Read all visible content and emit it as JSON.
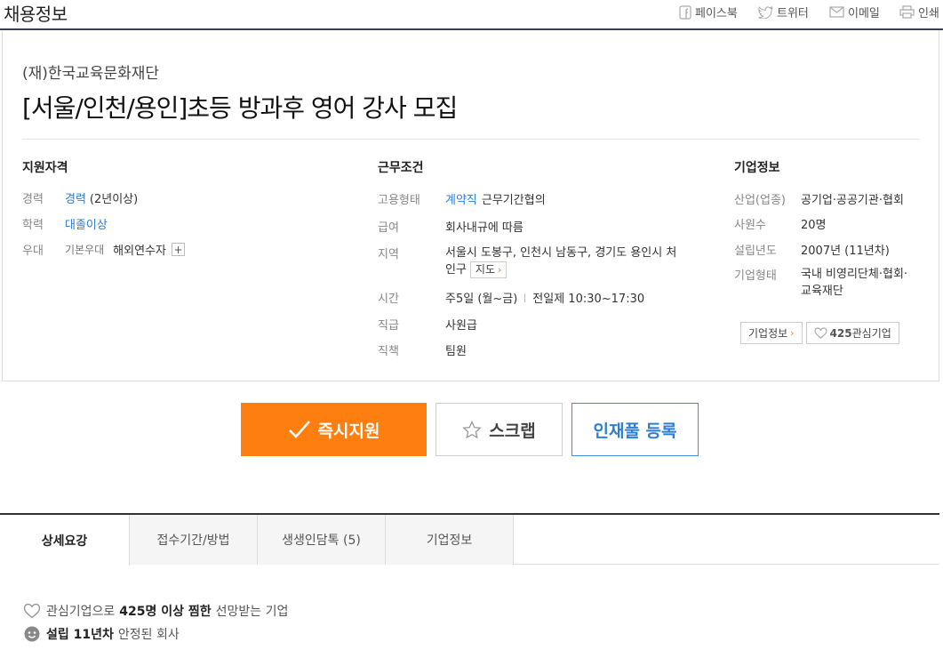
{
  "header": {
    "title": "채용정보",
    "share": {
      "facebook": "페이스북",
      "twitter": "트위터",
      "email": "이메일",
      "print": "인쇄"
    }
  },
  "job": {
    "company": "(재)한국교육문화재단",
    "title": "[서울/인천/용인]초등 방과후 영어 강사 모집"
  },
  "qualification": {
    "heading": "지원자격",
    "experience_label": "경력",
    "experience_value": "경력",
    "experience_detail": "(2년이상)",
    "education_label": "학력",
    "education_value": "대졸이상",
    "preference_label": "우대",
    "preference_sub": "기본우대",
    "preference_value": "해외연수자",
    "more": "+"
  },
  "conditions": {
    "heading": "근무조건",
    "employment_label": "고용형태",
    "employment_link": "계약직",
    "employment_value": "근무기간협의",
    "salary_label": "급여",
    "salary_value": "회사내규에 따름",
    "region_label": "지역",
    "region_line1": "서울시 도봉구, 인천시 남동구, 경기도 용인시 처",
    "region_line2": "인구",
    "map_button": "지도",
    "time_label": "시간",
    "time_days": "주5일 (월~금)",
    "time_hours": "전일제 10:30~17:30",
    "rank_label": "직급",
    "rank_value": "사원급",
    "position_label": "직책",
    "position_value": "팀원"
  },
  "company_info": {
    "heading": "기업정보",
    "industry_label": "산업(업종)",
    "industry_value": "공기업·공공기관·협회",
    "employees_label": "사원수",
    "employees_value": "20명",
    "founded_label": "설립년도",
    "founded_value": "2007년 (11년차)",
    "type_label": "기업형태",
    "type_line1": "국내 비영리단체·협회·",
    "type_line2": "교육재단",
    "info_button": "기업정보",
    "interest_count": "425",
    "interest_label": "관심기업"
  },
  "actions": {
    "apply": "즉시지원",
    "scrap": "스크랩",
    "talent_pool": "인재풀 등록"
  },
  "tabs": [
    {
      "label": "상세요강"
    },
    {
      "label": "접수기간/방법"
    },
    {
      "label": "생생인담톡 (5)"
    },
    {
      "label": "기업정보"
    }
  ],
  "features": {
    "f1_pre": "관심기업으로",
    "f1_bold": "425명 이상 찜한",
    "f1_post": "선망받는 기업",
    "f2_bold": "설립 11년차",
    "f2_post": "안정된 회사"
  },
  "colors": {
    "accent": "#ff7e10",
    "link": "#2d7ed6",
    "header_rule": "#3a3f51"
  }
}
